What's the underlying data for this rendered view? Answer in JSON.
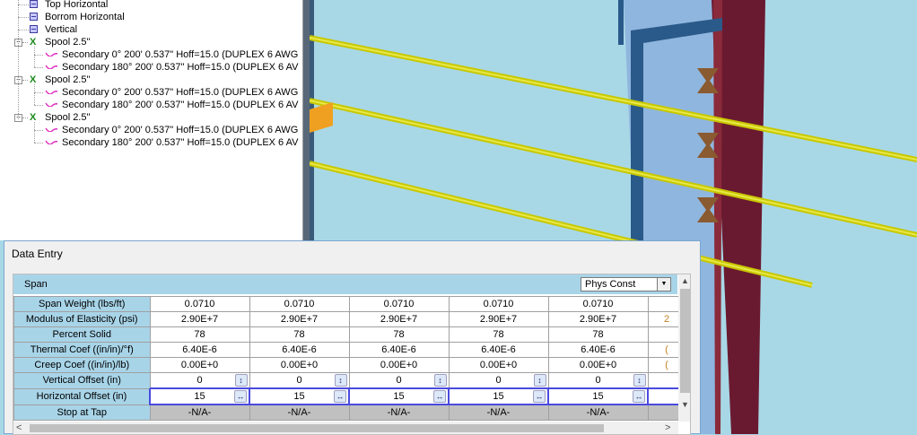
{
  "tree": {
    "items": [
      {
        "label": "Top Horizontal",
        "kind": "section"
      },
      {
        "label": "Borrom Horizontal",
        "kind": "section"
      },
      {
        "label": "Vertical",
        "kind": "section"
      },
      {
        "label": "Spool 2.5\"",
        "kind": "spool"
      },
      {
        "label": "Secondary 0° 200'  0.537\" Hoff=15.0   (DUPLEX 6 AWG",
        "kind": "wire"
      },
      {
        "label": "Secondary 180° 200'  0.537\" Hoff=15.0   (DUPLEX 6 AV",
        "kind": "wire"
      },
      {
        "label": "Spool 2.5\"",
        "kind": "spool"
      },
      {
        "label": "Secondary 0° 200'  0.537\" Hoff=15.0   (DUPLEX 6 AWG",
        "kind": "wire"
      },
      {
        "label": "Secondary 180° 200'  0.537\" Hoff=15.0   (DUPLEX 6 AV",
        "kind": "wire"
      },
      {
        "label": "Spool 2.5\"",
        "kind": "spool"
      },
      {
        "label": "Secondary 0° 200'  0.537\" Hoff=15.0   (DUPLEX 6 AWG",
        "kind": "wire"
      },
      {
        "label": "Secondary 180° 200'  0.537\" Hoff=15.0   (DUPLEX 6 AV",
        "kind": "wire"
      }
    ]
  },
  "data_entry": {
    "title": "Data Entry",
    "section_label": "Span",
    "dropdown": {
      "selected": "Phys Const"
    },
    "rows": [
      {
        "label": "Span Weight (lbs/ft)",
        "values": [
          "0.0710",
          "0.0710",
          "0.0710",
          "0.0710",
          "0.0710",
          ""
        ],
        "control": "none"
      },
      {
        "label": "Modulus of Elasticity (psi)",
        "values": [
          "2.90E+7",
          "2.90E+7",
          "2.90E+7",
          "2.90E+7",
          "2.90E+7",
          "2"
        ],
        "control": "none"
      },
      {
        "label": "Percent Solid",
        "values": [
          "78",
          "78",
          "78",
          "78",
          "78",
          ""
        ],
        "control": "none"
      },
      {
        "label": "Thermal Coef ((in/in)/°f)",
        "values": [
          "6.40E-6",
          "6.40E-6",
          "6.40E-6",
          "6.40E-6",
          "6.40E-6",
          "("
        ],
        "control": "none"
      },
      {
        "label": "Creep Coef ((in/in)/lb)",
        "values": [
          "0.00E+0",
          "0.00E+0",
          "0.00E+0",
          "0.00E+0",
          "0.00E+0",
          "("
        ],
        "control": "none"
      },
      {
        "label": "Vertical Offset (in)",
        "values": [
          "0",
          "0",
          "0",
          "0",
          "0",
          ""
        ],
        "control": "updown"
      },
      {
        "label": "Horizontal Offset (in)",
        "values": [
          "15",
          "15",
          "15",
          "15",
          "15",
          ""
        ],
        "control": "leftright"
      },
      {
        "label": "Stop at Tap",
        "values": [
          "-N/A-",
          "-N/A-",
          "-N/A-",
          "-N/A-",
          "-N/A-",
          ""
        ],
        "control": "na"
      }
    ]
  },
  "icons": {
    "section": "blue-square-icon",
    "spool": "spool-insulator-icon",
    "wire": "wire-wave-icon",
    "expand": "collapse-toggle-icon"
  },
  "colors": {
    "sky": "#a8d8e6",
    "header_blue": "#a8d4e8",
    "conductor_yellow": "#d6d600",
    "pole_blue": "#2a5a8a",
    "insulator_brown": "#8a5a30",
    "pole_maroon": "#6a1a30"
  }
}
